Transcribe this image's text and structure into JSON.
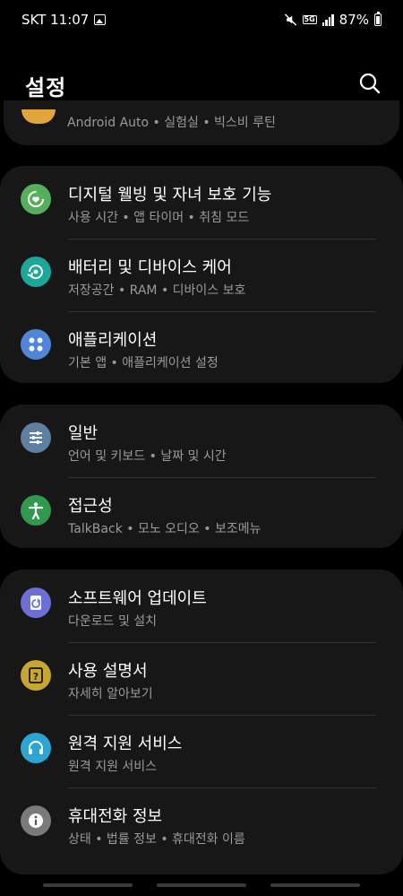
{
  "status": {
    "carrier_time": "SKT 11:07",
    "network": "5G",
    "battery": "87%"
  },
  "header": {
    "title": "설정"
  },
  "partial_item": {
    "sub": "Android Auto • 실험실 • 빅스비 루틴"
  },
  "groups": [
    {
      "items": [
        {
          "label": "디지털 웰빙 및 자녀 보호 기능",
          "sub": "사용 시간 • 앱 타이머 • 취침 모드",
          "icon": "digital-wellbeing-icon",
          "color": "#54b05a"
        },
        {
          "label": "배터리 및 디바이스 케어",
          "sub": "저장공간 • RAM • 디바이스 보호",
          "icon": "device-care-icon",
          "color": "#1aa89a"
        },
        {
          "label": "애플리케이션",
          "sub": "기본 앱 • 애플리케이션 설정",
          "icon": "apps-icon",
          "color": "#4f86d9"
        }
      ]
    },
    {
      "items": [
        {
          "label": "일반",
          "sub": "언어 및 키보드 • 날짜 및 시간",
          "icon": "general-sliders-icon",
          "color": "#5e7f9e"
        },
        {
          "label": "접근성",
          "sub": "TalkBack • 모노 오디오 • 보조메뉴",
          "icon": "accessibility-icon",
          "color": "#2f9a4d"
        }
      ]
    },
    {
      "items": [
        {
          "label": "소프트웨어 업데이트",
          "sub": "다운로드 및 설치",
          "icon": "software-update-icon",
          "color": "#6c6fd8"
        },
        {
          "label": "사용 설명서",
          "sub": "자세히 알아보기",
          "icon": "user-manual-icon",
          "color": "#c9a62c"
        },
        {
          "label": "원격 지원 서비스",
          "sub": "원격 지원 서비스",
          "icon": "headset-icon",
          "color": "#2aa6d4"
        },
        {
          "label": "휴대전화 정보",
          "sub": "상태 • 법률 정보 • 휴대전화 이름",
          "icon": "info-icon",
          "color": "#7a7a7a"
        }
      ]
    }
  ]
}
